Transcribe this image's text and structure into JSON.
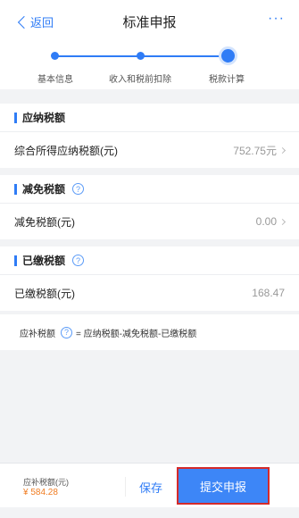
{
  "nav": {
    "back_label": "返回",
    "title": "标准申报",
    "more_label": "···"
  },
  "steps": [
    {
      "label": "基本信息"
    },
    {
      "label": "收入和税前扣除"
    },
    {
      "label": "税款计算"
    }
  ],
  "sections": {
    "payable": {
      "title": "应纳税额",
      "row_label": "综合所得应纳税额(元)",
      "row_value": "752.75元"
    },
    "reduction": {
      "title": "减免税额",
      "row_label": "减免税额(元)",
      "row_value": "0.00"
    },
    "paid": {
      "title": "已缴税额",
      "row_label": "已缴税额(元)",
      "row_value": "168.47"
    }
  },
  "formula": {
    "label": "应补税额",
    "expression": "= 应纳税额-减免税额-已缴税额"
  },
  "footer": {
    "total_label": "应补税额(元)",
    "total_value": "¥ 584.28",
    "save_label": "保存",
    "submit_label": "提交申报"
  },
  "colors": {
    "accent": "#2f7cf6",
    "orange": "#f07c21",
    "highlight_border": "#d42a2a"
  }
}
